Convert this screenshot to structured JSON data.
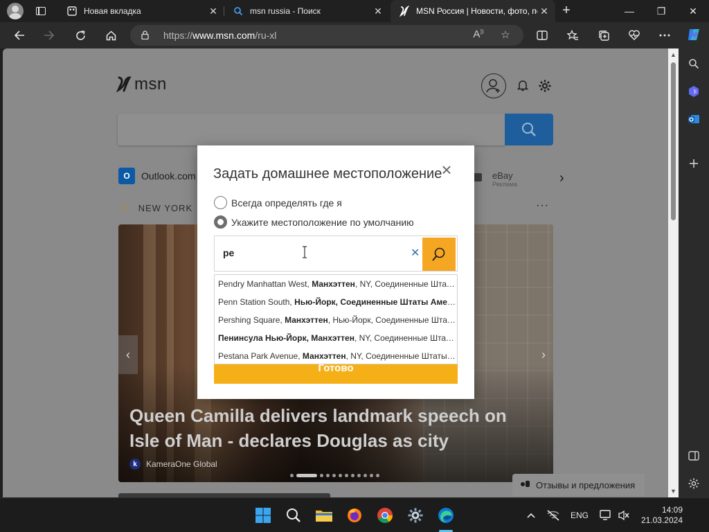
{
  "browser": {
    "tabs": [
      {
        "title": "Новая вкладка",
        "close": "✕"
      },
      {
        "title": "msn russia - Поиск",
        "close": "✕"
      },
      {
        "title": "MSN Россия | Новости, фото, по",
        "close": "✕",
        "active": true
      }
    ],
    "new_tab": "+",
    "window": {
      "minimize": "—",
      "restore": "❐",
      "close": "✕"
    },
    "url_host": "https://www.msn.com",
    "url_path": "/ru-xl",
    "url_prefix": "https://",
    "url_domain": "www.msn.com",
    "url_rest": "/ru-xl"
  },
  "msn": {
    "logo_text": "msn",
    "quick_links": [
      {
        "label": "Outlook.com",
        "icon": "outlook-icon"
      },
      {
        "label": "eBay",
        "sub": "Реклама"
      }
    ],
    "weather_label": "NEW YORK",
    "hero": {
      "title": "Queen Camilla delivers landmark speech on Isle of Man - declares Douglas as city",
      "source": "KameraOne Global",
      "source_initial": "k",
      "pages": 12,
      "current_page": 2
    },
    "feedback": "Отзывы и предложения"
  },
  "modal": {
    "title": "Задать домашнее местоположение",
    "options": [
      {
        "label": "Всегда определять где я",
        "checked": false
      },
      {
        "label": "Укажите местоположение по умолчанию",
        "checked": true
      }
    ],
    "input_value": "pe",
    "suggestions": [
      {
        "normal": "Pendry Manhattan West, ",
        "bold": "Манхэттен",
        "rest": ", NY, Соединенные Штаты Америки"
      },
      {
        "normal": "Penn Station South, ",
        "bold": "Нью-Йорк, Соединенные Штаты Америки",
        "rest": ""
      },
      {
        "normal": "Pershing Square, ",
        "bold": "Манхэттен",
        "rest": ", Нью-Йорк, Соединенные Штаты Америки"
      },
      {
        "normal": "",
        "bold": "Пенинсула Нью-Йорк, Манхэттен",
        "rest": ", NY, Соединенные Штаты Америки"
      },
      {
        "normal": "Pestana Park Avenue, ",
        "bold": "Манхэттен",
        "rest": ", NY, Соединенные Штаты Америки"
      }
    ],
    "done_label": "Готово"
  },
  "taskbar": {
    "language": "ENG",
    "time": "14:09",
    "date": "21.03.2024"
  },
  "colors": {
    "accent_blue": "#1f5e9c",
    "done_orange": "#f5b018",
    "search_orange": "#f5a623"
  }
}
